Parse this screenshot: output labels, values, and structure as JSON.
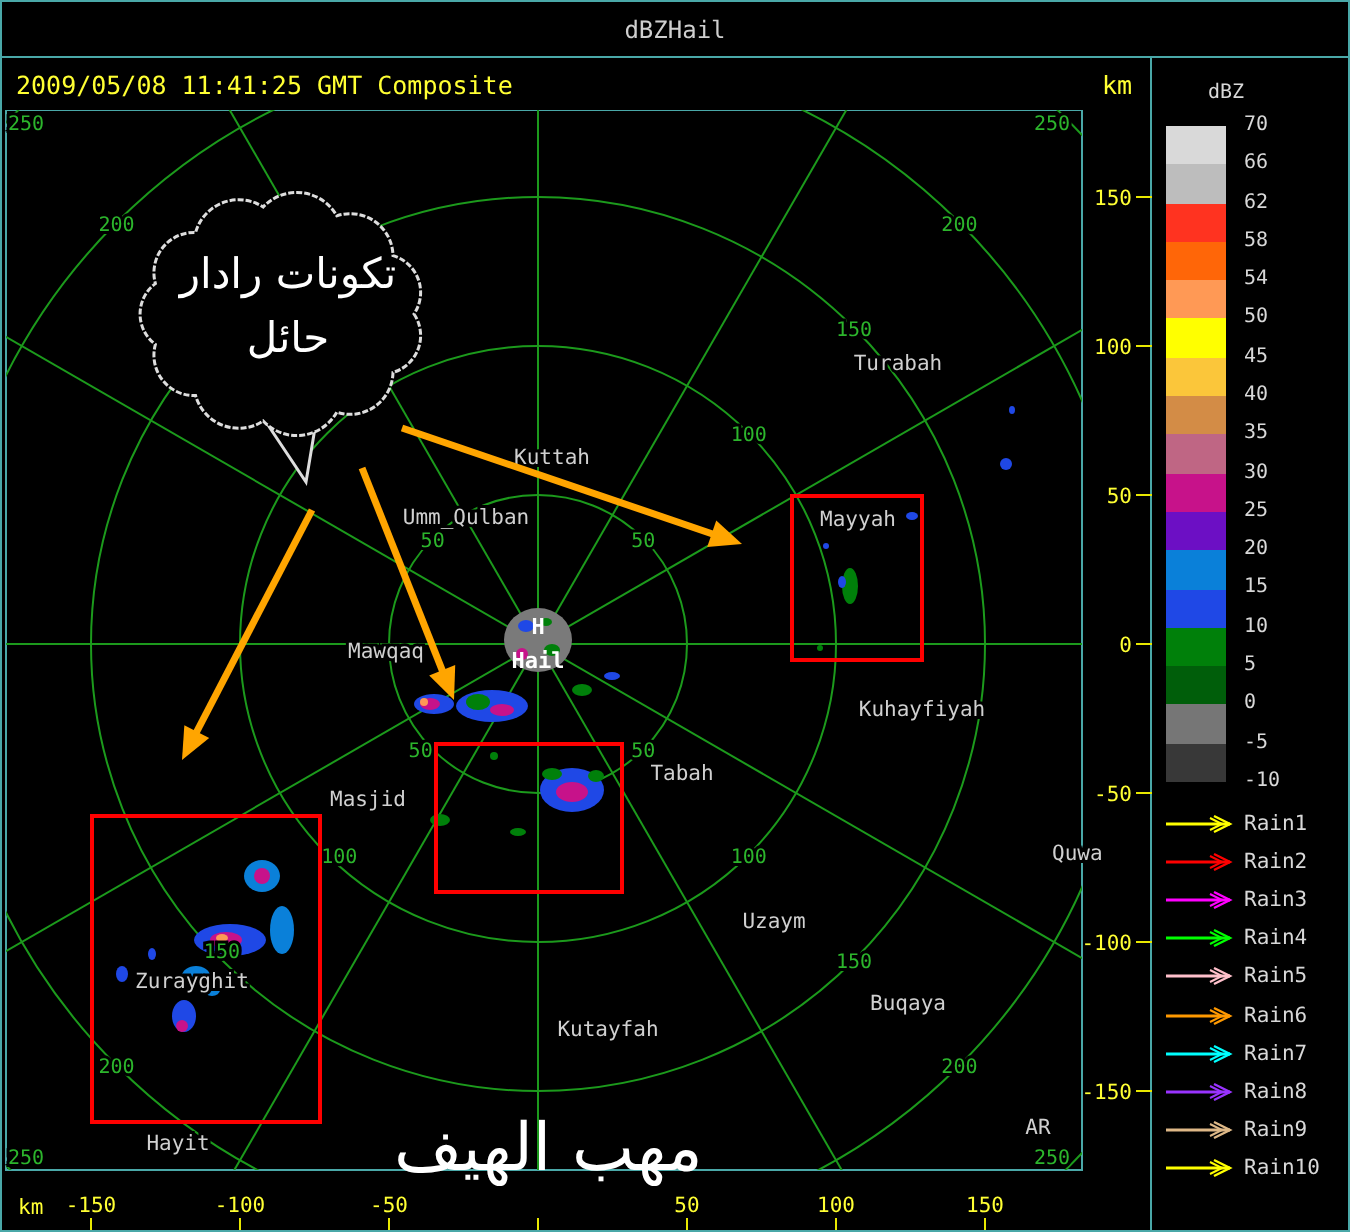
{
  "window": {
    "title": "dBZHail"
  },
  "header": {
    "timestamp": "2009/05/08 11:41:25 GMT Composite",
    "unit": "km"
  },
  "radar_map": {
    "rings": [
      {
        "nw": "50",
        "ne": "50",
        "sw": "50",
        "se": "50"
      },
      {
        "ne": "100",
        "sw": "100",
        "se": "100"
      },
      {
        "ne": "150",
        "sw": "150",
        "se": "150"
      },
      {
        "nw": "200",
        "ne": "200",
        "sw": "200",
        "se": "200"
      },
      {
        "nw": "250",
        "ne": "250",
        "sw": "250",
        "se": "250"
      }
    ],
    "places": [
      {
        "name": "Turabah"
      },
      {
        "name": "Kuttah"
      },
      {
        "name": "Mayyah"
      },
      {
        "name": "Umm_Qulban"
      },
      {
        "name": "Mawqaq"
      },
      {
        "name": "Kuhayfiyah"
      },
      {
        "name": "Tabah"
      },
      {
        "name": "Masjid"
      },
      {
        "name": "Quwa"
      },
      {
        "name": "Uzaym"
      },
      {
        "name": "Zurayghit"
      },
      {
        "name": "Buqaya"
      },
      {
        "name": "Kutayfah"
      },
      {
        "name": "Hayit"
      }
    ],
    "site": {
      "marker": "H",
      "name": "Hail"
    },
    "corner_label": "AR",
    "callout": {
      "text": "تكونات رادار حائل"
    },
    "overlay_title": "مهب الهيف"
  },
  "y_axis": {
    "ticks": [
      "150",
      "100",
      "50",
      "0",
      "-50",
      "-100",
      "-150"
    ]
  },
  "x_axis": {
    "unit": "km",
    "ticks": [
      "-150",
      "-100",
      "-50",
      "50",
      "100",
      "150"
    ]
  },
  "legend": {
    "title": "dBZ",
    "swatches": [
      {
        "color": "#d9d9d9"
      },
      {
        "color": "#bdbdbd"
      },
      {
        "color": "#ff3320"
      },
      {
        "color": "#ff6608"
      },
      {
        "color": "#ff9955"
      },
      {
        "color": "#ffff00"
      },
      {
        "color": "#fbc63a"
      },
      {
        "color": "#d38c46"
      },
      {
        "color": "#bf6684"
      },
      {
        "color": "#c7128a"
      },
      {
        "color": "#6c0fc4"
      },
      {
        "color": "#0a80d9"
      },
      {
        "color": "#1f48e6"
      },
      {
        "color": "#00800a"
      },
      {
        "color": "#005e0a"
      },
      {
        "color": "#767676"
      },
      {
        "color": "#383838"
      }
    ],
    "labels": [
      "70",
      "66",
      "62",
      "58",
      "54",
      "50",
      "45",
      "40",
      "35",
      "30",
      "25",
      "20",
      "15",
      "10",
      "5",
      "0",
      "-5",
      "-10"
    ],
    "tracks": [
      {
        "label": "Rain1",
        "color": "#ffff00"
      },
      {
        "label": "Rain2",
        "color": "#ff0000"
      },
      {
        "label": "Rain3",
        "color": "#ff00ff"
      },
      {
        "label": "Rain4",
        "color": "#00ff00"
      },
      {
        "label": "Rain5",
        "color": "#ffc0cb"
      },
      {
        "label": "Rain6",
        "color": "#ff9900"
      },
      {
        "label": "Rain7",
        "color": "#00ffff"
      },
      {
        "label": "Rain8",
        "color": "#9933ff"
      },
      {
        "label": "Rain9",
        "color": "#deb887"
      },
      {
        "label": "Rain10",
        "color": "#ffff00"
      }
    ]
  }
}
